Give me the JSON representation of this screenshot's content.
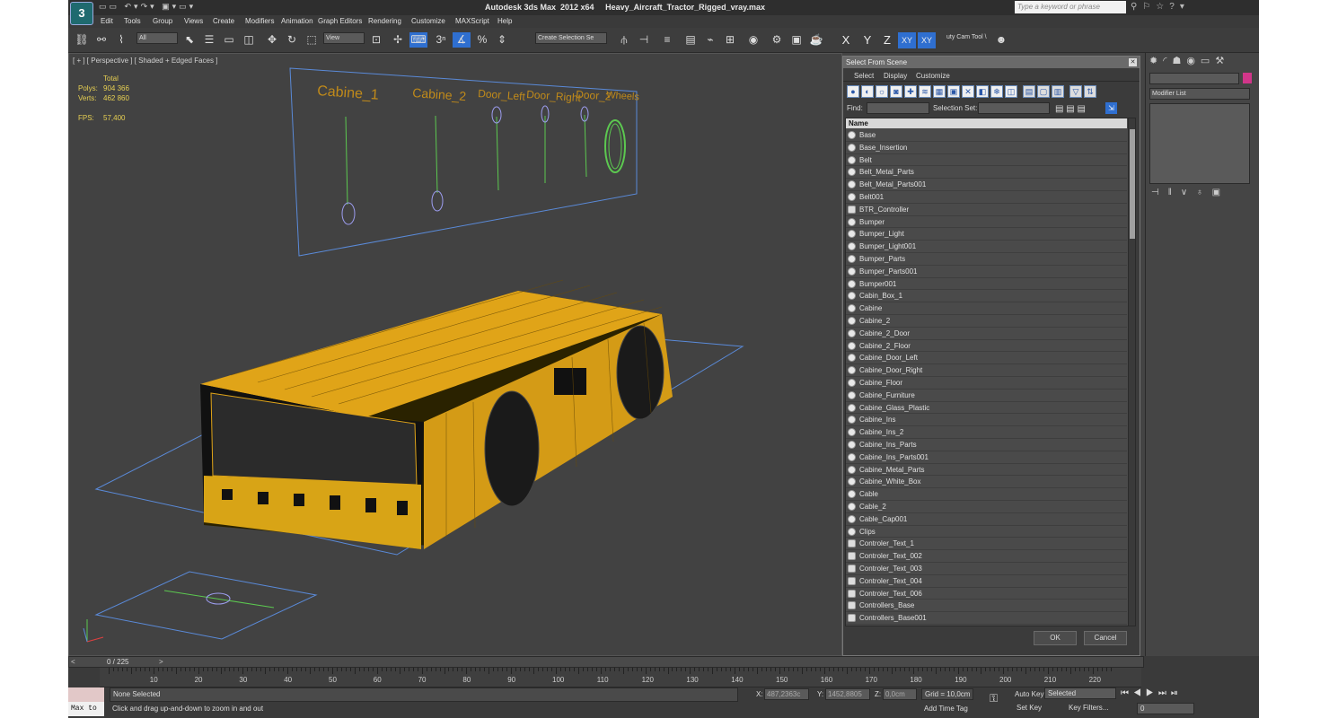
{
  "window": {
    "title": "Autodesk 3ds Max  2012 x64     Heavy_Aircraft_Tractor_Rigged_vray.max",
    "search_placeholder": "Type a keyword or phrase"
  },
  "menu": [
    "Edit",
    "Tools",
    "Group",
    "Views",
    "Create",
    "Modifiers",
    "Animation",
    "Graph Editors",
    "Rendering",
    "Customize",
    "MAXScript",
    "Help"
  ],
  "toolbar": {
    "selection_filter": "All",
    "ref_coord": "View",
    "named_selection_placeholder": "Create Selection Se",
    "axis_x": "X",
    "axis_y": "Y",
    "axis_z": "Z",
    "axis_xy": "XY",
    "axis_xy2": "XY",
    "cam_tool": "uty Cam Tool \\"
  },
  "viewport": {
    "label": "[ + ] [ Perspective ] [ Shaded + Edged Faces ]",
    "stats_total": "Total",
    "polys_label": "Polys:",
    "polys_value": "904 366",
    "verts_label": "Verts:",
    "verts_value": "462 860",
    "fps_label": "FPS:",
    "fps_value": "57,400",
    "controls": [
      "Cabine_1",
      "Cabine_2",
      "Door_Left",
      "Door_Right",
      "Door_2",
      "Wheels"
    ]
  },
  "dialog": {
    "title": "Select From Scene",
    "menu": [
      "Select",
      "Display",
      "Customize"
    ],
    "find_label": "Find:",
    "selection_set_label": "Selection Set:",
    "column_header": "Name",
    "items": [
      {
        "name": "Base",
        "type": "object"
      },
      {
        "name": "Base_Insertion",
        "type": "object"
      },
      {
        "name": "Belt",
        "type": "object"
      },
      {
        "name": "Belt_Metal_Parts",
        "type": "object"
      },
      {
        "name": "Belt_Metal_Parts001",
        "type": "object"
      },
      {
        "name": "Belt001",
        "type": "object"
      },
      {
        "name": "BTR_Controller",
        "type": "controller"
      },
      {
        "name": "Bumper",
        "type": "object"
      },
      {
        "name": "Bumper_Light",
        "type": "object"
      },
      {
        "name": "Bumper_Light001",
        "type": "object"
      },
      {
        "name": "Bumper_Parts",
        "type": "object"
      },
      {
        "name": "Bumper_Parts001",
        "type": "object"
      },
      {
        "name": "Bumper001",
        "type": "object"
      },
      {
        "name": "Cabin_Box_1",
        "type": "object"
      },
      {
        "name": "Cabine",
        "type": "object"
      },
      {
        "name": "Cabine_2",
        "type": "object"
      },
      {
        "name": "Cabine_2_Door",
        "type": "object"
      },
      {
        "name": "Cabine_2_Floor",
        "type": "object"
      },
      {
        "name": "Cabine_Door_Left",
        "type": "object"
      },
      {
        "name": "Cabine_Door_Right",
        "type": "object"
      },
      {
        "name": "Cabine_Floor",
        "type": "object"
      },
      {
        "name": "Cabine_Furniture",
        "type": "object"
      },
      {
        "name": "Cabine_Glass_Plastic",
        "type": "object"
      },
      {
        "name": "Cabine_Ins",
        "type": "object"
      },
      {
        "name": "Cabine_Ins_2",
        "type": "object"
      },
      {
        "name": "Cabine_Ins_Parts",
        "type": "object"
      },
      {
        "name": "Cabine_Ins_Parts001",
        "type": "object"
      },
      {
        "name": "Cabine_Metal_Parts",
        "type": "object"
      },
      {
        "name": "Cabine_White_Box",
        "type": "object"
      },
      {
        "name": "Cable",
        "type": "object"
      },
      {
        "name": "Cable_2",
        "type": "object"
      },
      {
        "name": "Cable_Cap001",
        "type": "object"
      },
      {
        "name": "Clips",
        "type": "object"
      },
      {
        "name": "Controler_Text_1",
        "type": "controller"
      },
      {
        "name": "Controler_Text_002",
        "type": "controller"
      },
      {
        "name": "Controler_Text_003",
        "type": "controller"
      },
      {
        "name": "Controler_Text_004",
        "type": "controller"
      },
      {
        "name": "Controler_Text_006",
        "type": "controller"
      },
      {
        "name": "Controllers_Base",
        "type": "controller"
      },
      {
        "name": "Controllers_Base001",
        "type": "controller"
      }
    ],
    "ok_label": "OK",
    "cancel_label": "Cancel"
  },
  "command_panel": {
    "modifier_list": "Modifier List",
    "object_color": "#d1368a"
  },
  "timeline": {
    "slider_text": "0 / 225",
    "ticks": [
      "10",
      "20",
      "30",
      "40",
      "50",
      "60",
      "70",
      "80",
      "90",
      "100",
      "110",
      "120",
      "130",
      "140",
      "150",
      "160",
      "170",
      "180",
      "190",
      "200",
      "210",
      "220"
    ]
  },
  "status": {
    "selection": "None Selected",
    "prompt": "Click and drag up-and-down to zoom in and out",
    "x_label": "X:",
    "x_value": "487,2363c",
    "y_label": "Y:",
    "y_value": "1452,8805",
    "z_label": "Z:",
    "z_value": "0,0cm",
    "grid": "Grid = 10,0cm",
    "add_time_tag": "Add Time Tag",
    "auto_key": "Auto Key",
    "set_key": "Set Key",
    "selected_dropdown": "Selected",
    "key_filters": "Key Filters...",
    "frame": "0",
    "maxscript": "Max to"
  },
  "colors": {
    "viewport_bg": "#424242",
    "wire_orange": "#f0b020",
    "stats_yellow": "#e6cf52",
    "control_text": "#c08a1a",
    "grid_blue": "#5a8ad8"
  }
}
